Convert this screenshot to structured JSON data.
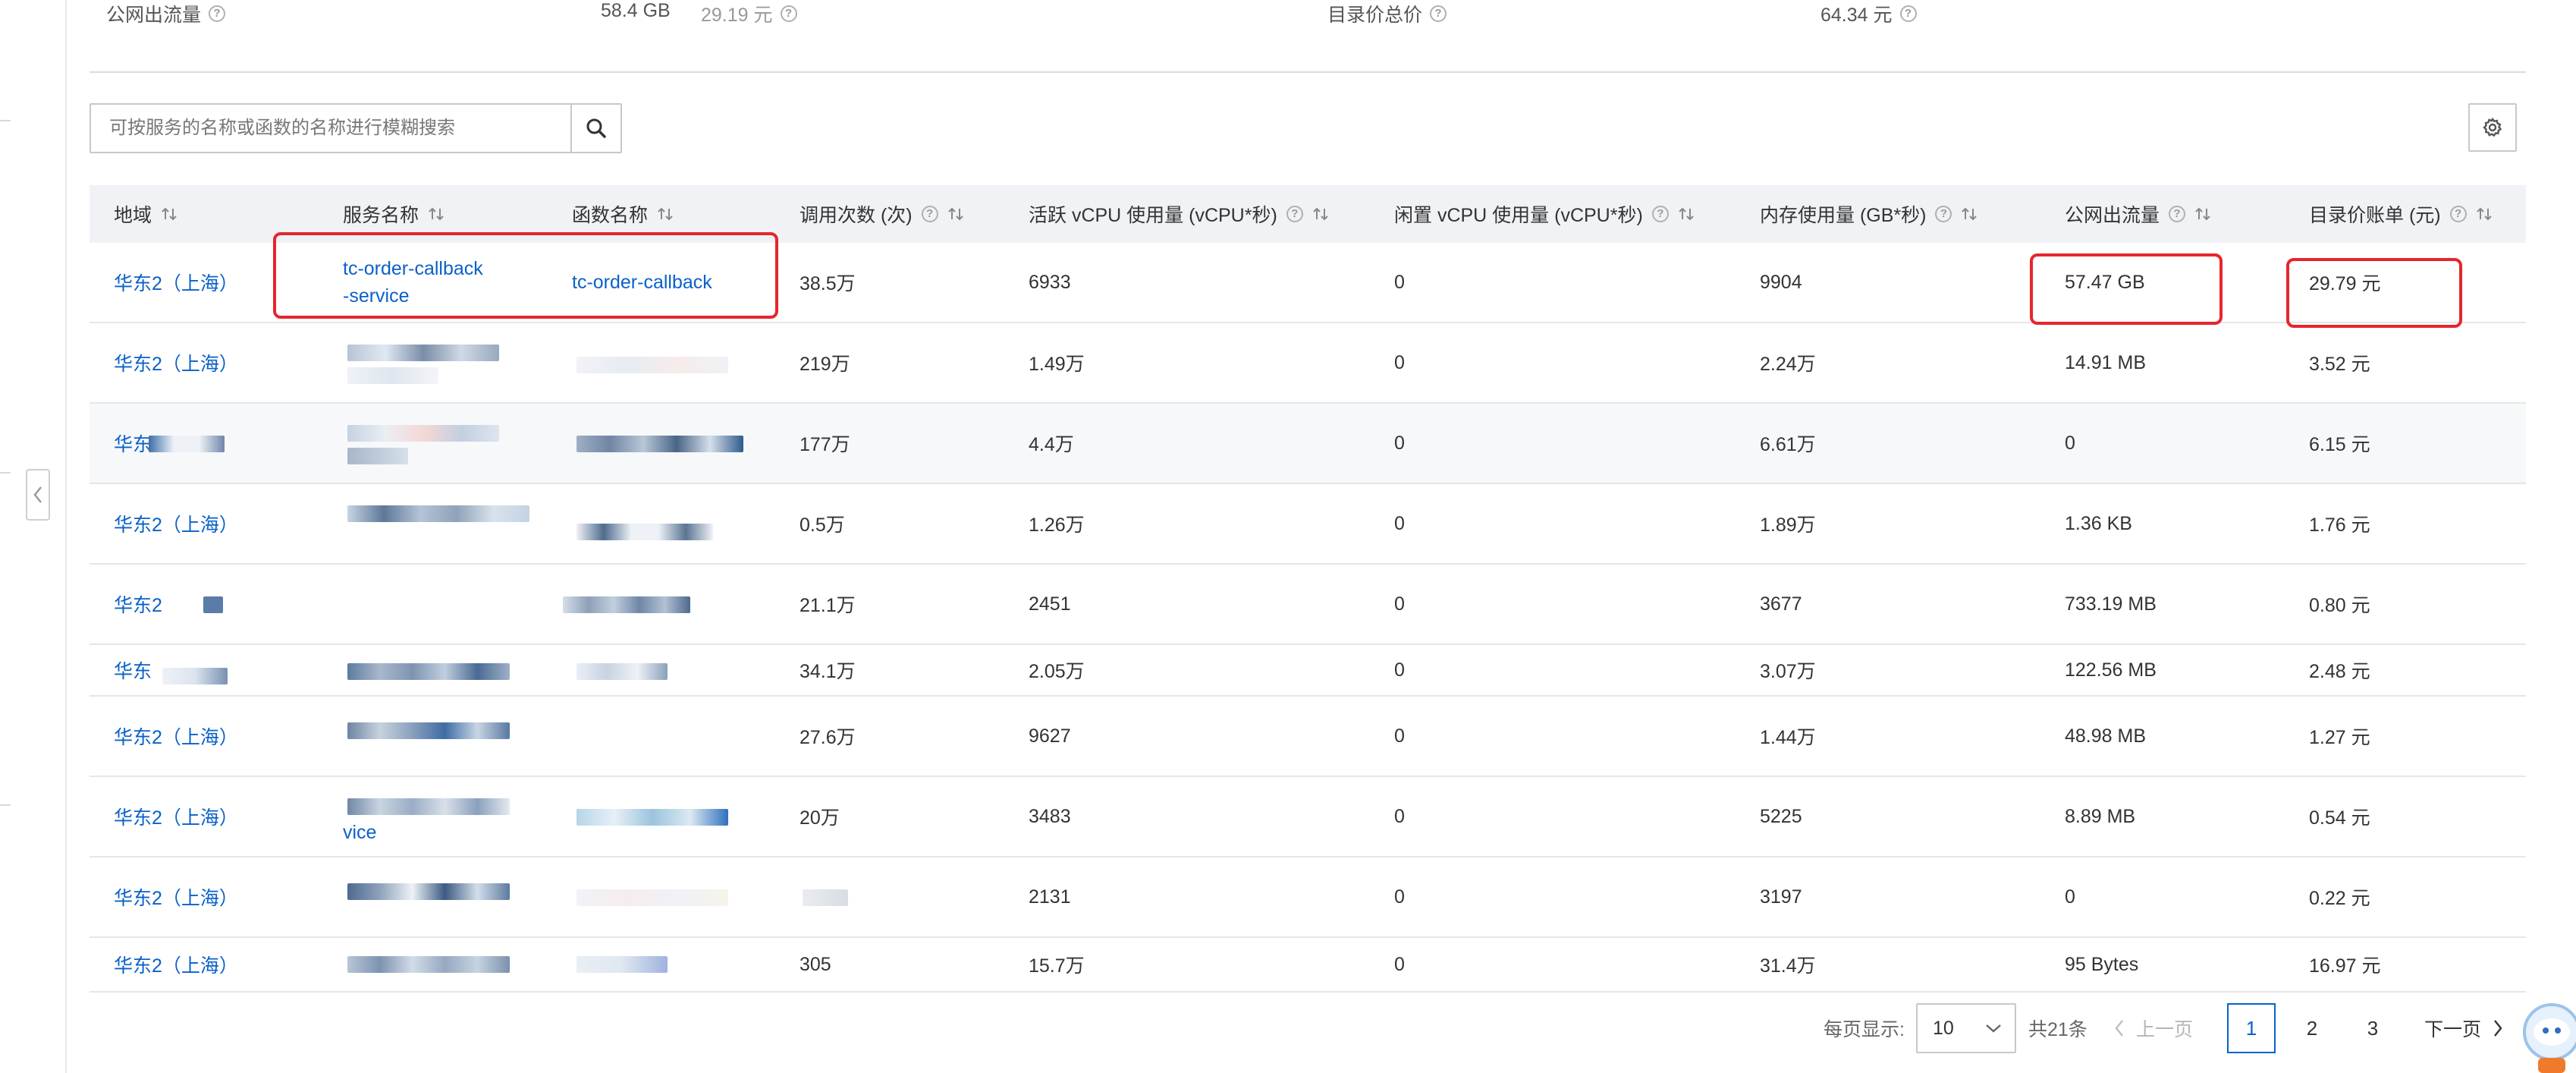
{
  "summary": {
    "public_egress_label": "公网出流量",
    "public_egress_value": "58.4 GB",
    "public_egress_price": "29.19 元",
    "list_total_label": "目录价总价",
    "list_total_value": "64.34 元"
  },
  "search": {
    "placeholder": "可按服务的名称或函数的名称进行模糊搜索"
  },
  "columns": {
    "region": "地域",
    "service": "服务名称",
    "function": "函数名称",
    "invocations": "调用次数 (次)",
    "active_vcpu": "活跃 vCPU 使用量 (vCPU*秒)",
    "idle_vcpu": "闲置 vCPU 使用量 (vCPU*秒)",
    "memory": "内存使用量 (GB*秒)",
    "egress": "公网出流量",
    "bill": "目录价账单 (元)"
  },
  "rows": [
    {
      "region": "华东2（上海）",
      "service": "tc-order-callback-service",
      "function": "tc-order-callback",
      "invocations": "38.5万",
      "active_vcpu": "6933",
      "idle_vcpu": "0",
      "memory": "9904",
      "egress": "57.47 GB",
      "bill": "29.79 元"
    },
    {
      "region": "华东2（上海）",
      "service": "",
      "function": "",
      "invocations": "219万",
      "active_vcpu": "1.49万",
      "idle_vcpu": "0",
      "memory": "2.24万",
      "egress": "14.91 MB",
      "bill": "3.52 元"
    },
    {
      "region": "华东",
      "service": "",
      "function": "",
      "invocations": "177万",
      "active_vcpu": "4.4万",
      "idle_vcpu": "0",
      "memory": "6.61万",
      "egress": "0",
      "bill": "6.15 元"
    },
    {
      "region": "华东2（上海）",
      "service": "",
      "function": "",
      "invocations": "0.5万",
      "active_vcpu": "1.26万",
      "idle_vcpu": "0",
      "memory": "1.89万",
      "egress": "1.36 KB",
      "bill": "1.76 元"
    },
    {
      "region": "华东2",
      "service": "",
      "function": "",
      "invocations": "21.1万",
      "active_vcpu": "2451",
      "idle_vcpu": "0",
      "memory": "3677",
      "egress": "733.19 MB",
      "bill": "0.80 元"
    },
    {
      "region": "华东",
      "service": "",
      "function": "",
      "invocations": "34.1万",
      "active_vcpu": "2.05万",
      "idle_vcpu": "0",
      "memory": "3.07万",
      "egress": "122.56 MB",
      "bill": "2.48 元"
    },
    {
      "region": "华东2（上海）",
      "service": "",
      "function": "",
      "invocations": "27.6万",
      "active_vcpu": "9627",
      "idle_vcpu": "0",
      "memory": "1.44万",
      "egress": "48.98 MB",
      "bill": "1.27 元"
    },
    {
      "region": "华东2（上海）",
      "service": "vice",
      "function": "",
      "invocations": "20万",
      "active_vcpu": "3483",
      "idle_vcpu": "0",
      "memory": "5225",
      "egress": "8.89 MB",
      "bill": "0.54 元"
    },
    {
      "region": "华东2（上海）",
      "service": "",
      "function": "",
      "invocations": "",
      "active_vcpu": "2131",
      "idle_vcpu": "0",
      "memory": "3197",
      "egress": "0",
      "bill": "0.22 元"
    },
    {
      "region": "华东2（上海）",
      "service": "",
      "function": "",
      "invocations": "305",
      "active_vcpu": "15.7万",
      "idle_vcpu": "0",
      "memory": "31.4万",
      "egress": "95 Bytes",
      "bill": "16.97 元"
    }
  ],
  "pagination": {
    "page_size_label": "每页显示:",
    "page_size": "10",
    "total": "共21条",
    "prev": "上一页",
    "pages": [
      "1",
      "2",
      "3"
    ],
    "next": "下一页"
  },
  "colors": {
    "link": "#0a61c9",
    "highlight": "#e5262d",
    "header_bg": "#f0f2f5"
  }
}
